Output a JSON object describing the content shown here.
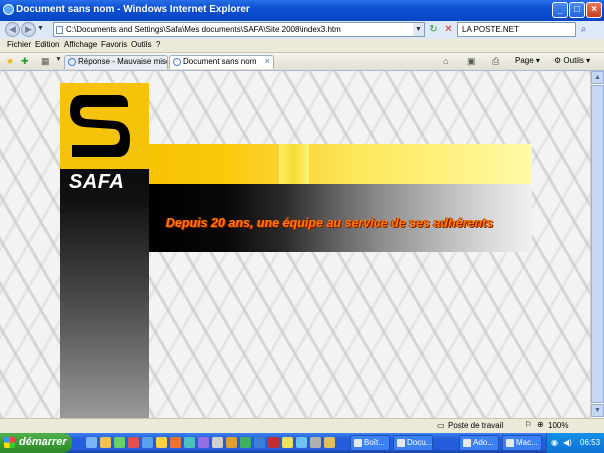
{
  "window": {
    "title": "Document sans nom - Windows Internet Explorer"
  },
  "address": {
    "url": "C:\\Documents and Settings\\Safa\\Mes documents\\SAFA\\Site 2008\\index3.htm"
  },
  "search": {
    "value": "LA POSTE.NET"
  },
  "menu": [
    "Fichier",
    "Edition",
    "Affichage",
    "Favoris",
    "Outils",
    "?"
  ],
  "tabs": [
    {
      "label": "Réponse - Mauvaise mise en ..."
    },
    {
      "label": "Document sans nom"
    }
  ],
  "toolbar": {
    "page_label": "Page",
    "tools_label": "Outils"
  },
  "page": {
    "logo_text": "SAFA",
    "tagline": "Depuis 20 ans, une équipe au service de ses adhérents"
  },
  "status": {
    "zone": "Poste de travail",
    "zoom": "100%"
  },
  "taskbar": {
    "start_label": "démarrer",
    "tasks": [
      "Boît...",
      "Ado...",
      "Docu...",
      "Mac..."
    ],
    "clock": "06:53"
  }
}
